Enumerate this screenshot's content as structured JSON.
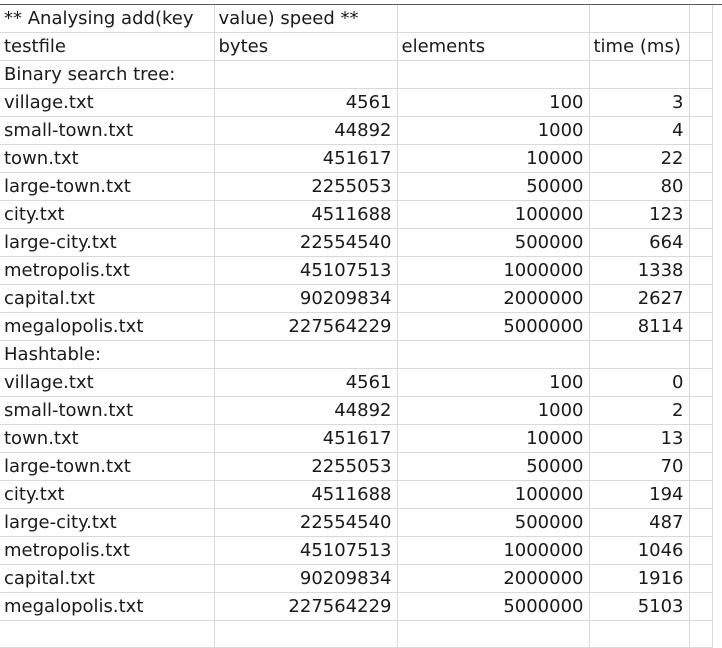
{
  "sheet": {
    "title_a": "** Analysing add(key",
    "title_b": "value) speed **",
    "headers": [
      "testfile",
      "bytes",
      "elements",
      "time (ms)"
    ],
    "sections": [
      {
        "label": "Binary search tree:",
        "rows": [
          [
            "village.txt",
            "4561",
            "100",
            "3"
          ],
          [
            "small-town.txt",
            "44892",
            "1000",
            "4"
          ],
          [
            "town.txt",
            "451617",
            "10000",
            "22"
          ],
          [
            "large-town.txt",
            "2255053",
            "50000",
            "80"
          ],
          [
            "city.txt",
            "4511688",
            "100000",
            "123"
          ],
          [
            "large-city.txt",
            "22554540",
            "500000",
            "664"
          ],
          [
            "metropolis.txt",
            "45107513",
            "1000000",
            "1338"
          ],
          [
            "capital.txt",
            "90209834",
            "2000000",
            "2627"
          ],
          [
            "megalopolis.txt",
            "227564229",
            "5000000",
            "8114"
          ]
        ]
      },
      {
        "label": "Hashtable:",
        "rows": [
          [
            "village.txt",
            "4561",
            "100",
            "0"
          ],
          [
            "small-town.txt",
            "44892",
            "1000",
            "2"
          ],
          [
            "town.txt",
            "451617",
            "10000",
            "13"
          ],
          [
            "large-town.txt",
            "2255053",
            "50000",
            "70"
          ],
          [
            "city.txt",
            "4511688",
            "100000",
            "194"
          ],
          [
            "large-city.txt",
            "22554540",
            "500000",
            "487"
          ],
          [
            "metropolis.txt",
            "45107513",
            "1000000",
            "1046"
          ],
          [
            "capital.txt",
            "90209834",
            "2000000",
            "1916"
          ],
          [
            "megalopolis.txt",
            "227564229",
            "5000000",
            "5103"
          ]
        ]
      }
    ]
  }
}
